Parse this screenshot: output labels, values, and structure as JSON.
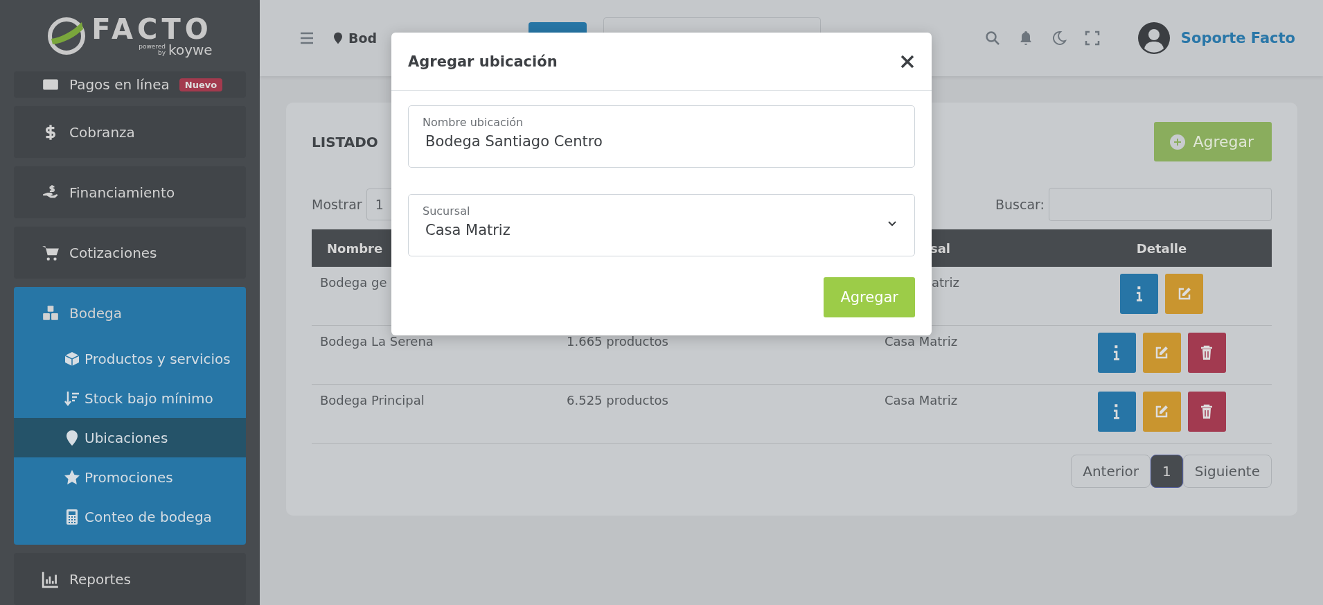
{
  "brand": {
    "name": "FACTO",
    "powered": "powered",
    "by": "by",
    "company": "koywe"
  },
  "header": {
    "location": "Bod",
    "user": "Soporte Facto"
  },
  "sidebar": {
    "items": [
      {
        "label": "Pagos en línea",
        "badge": "Nuevo",
        "expanded": false
      },
      {
        "label": "Cobranza",
        "expanded": false
      },
      {
        "label": "Financiamiento",
        "expanded": false
      },
      {
        "label": "Cotizaciones",
        "expanded": false
      },
      {
        "label": "Bodega",
        "expanded": true,
        "children": [
          {
            "label": "Productos y servicios",
            "selected": false
          },
          {
            "label": "Stock bajo mínimo",
            "selected": false
          },
          {
            "label": "Ubicaciones",
            "selected": true
          },
          {
            "label": "Promociones",
            "selected": false
          },
          {
            "label": "Conteo de bodega",
            "selected": false
          }
        ]
      },
      {
        "label": "Reportes",
        "expanded": false
      }
    ]
  },
  "content": {
    "title": "LISTADO",
    "add_button": "Agregar",
    "show_label": "Mostrar",
    "page_size": "1",
    "search_label": "Buscar:",
    "table": {
      "columns": [
        "Nombre",
        "sal",
        "Detalle"
      ],
      "rows": [
        {
          "name": "Bodega ge",
          "branch": "atriz",
          "deletable": false
        },
        {
          "name": "Bodega La Serena",
          "count": "1.665 productos",
          "branch": "Casa Matriz",
          "deletable": true
        },
        {
          "name": "Bodega Principal",
          "count": "6.525 productos",
          "branch": "Casa Matriz",
          "deletable": true
        }
      ]
    },
    "pagination": {
      "previous": "Anterior",
      "pages": [
        {
          "label": "1",
          "selected": true
        }
      ],
      "next": "Siguiente"
    }
  },
  "modal": {
    "title": "Agregar ubicación",
    "fields": [
      {
        "kind": "text",
        "label": "Nombre ubicación",
        "value": "Bodega Santiago Centro"
      },
      {
        "kind": "select",
        "label": "Sucursal",
        "value": "Casa Matriz"
      }
    ],
    "submit": "Agregar"
  }
}
